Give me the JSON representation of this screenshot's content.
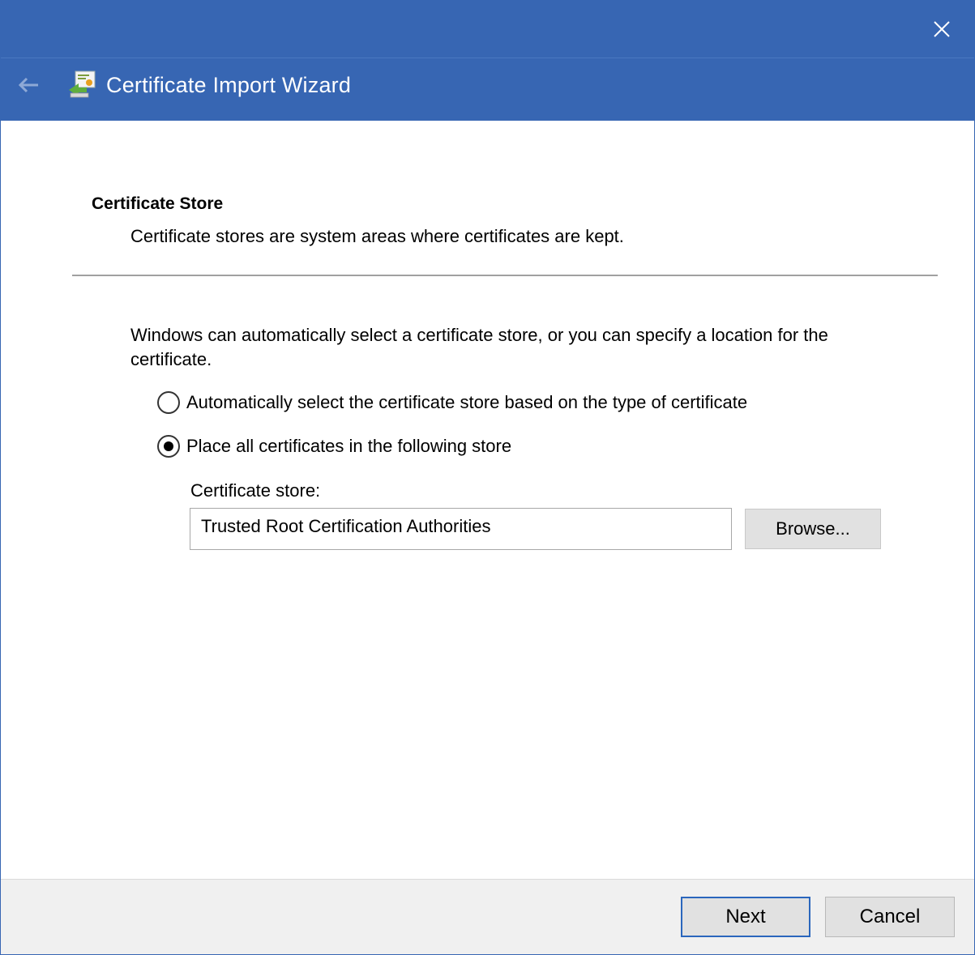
{
  "window": {
    "title": "Certificate Import Wizard",
    "accent_color": "#3766b3",
    "icons": {
      "close": "close-icon",
      "back": "back-arrow-icon",
      "wizard": "certificate-wizard-icon"
    }
  },
  "page": {
    "heading": "Certificate Store",
    "subheading": "Certificate stores are system areas where certificates are kept.",
    "description": "Windows can automatically select a certificate store, or you can specify a location for the certificate."
  },
  "options": [
    {
      "label": "Automatically select the certificate store based on the type of certificate",
      "selected": false
    },
    {
      "label": "Place all certificates in the following store",
      "selected": true
    }
  ],
  "store": {
    "label": "Certificate store:",
    "value": "Trusted Root Certification Authorities",
    "browse_label": "Browse..."
  },
  "footer": {
    "next_label": "Next",
    "cancel_label": "Cancel"
  }
}
